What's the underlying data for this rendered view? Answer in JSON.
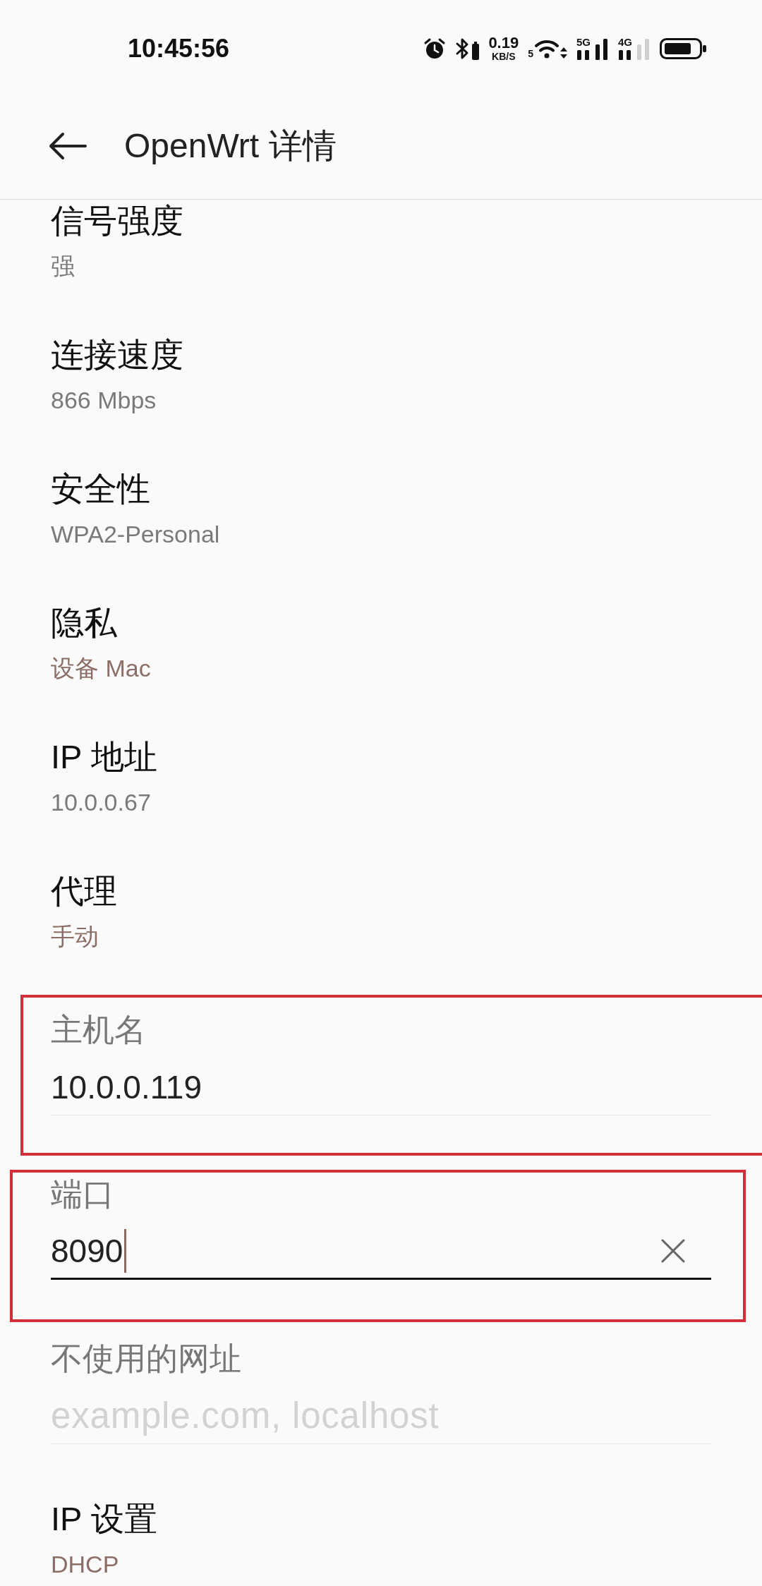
{
  "status_bar": {
    "time": "10:45:56",
    "net_speed": "0.19",
    "net_speed_unit": "KB/S",
    "wifi_band": "5",
    "sim_1_network": "5G",
    "sim_2_network": "4G"
  },
  "header": {
    "title": "OpenWrt 详情"
  },
  "details": [
    {
      "label": "信号强度",
      "value": "强",
      "accent": false
    },
    {
      "label": "连接速度",
      "value": "866 Mbps",
      "accent": false
    },
    {
      "label": "安全性",
      "value": "WPA2-Personal",
      "accent": false
    },
    {
      "label": "隐私",
      "value": "设备 Mac",
      "accent": true
    },
    {
      "label": "IP 地址",
      "value": "10.0.0.67",
      "accent": false
    },
    {
      "label": "代理",
      "value": "手动",
      "accent": true
    }
  ],
  "proxy_fields": [
    {
      "label": "主机名",
      "value": "10.0.0.119",
      "focused": false,
      "highlighted": true
    },
    {
      "label": "端口",
      "value": "8090",
      "focused": true,
      "highlighted": true
    },
    {
      "label": "不使用的网址",
      "placeholder": "example.com, localhost",
      "focused": false,
      "highlighted": false
    }
  ],
  "ip_settings": {
    "label": "IP 设置",
    "value": "DHCP",
    "accent": true
  }
}
